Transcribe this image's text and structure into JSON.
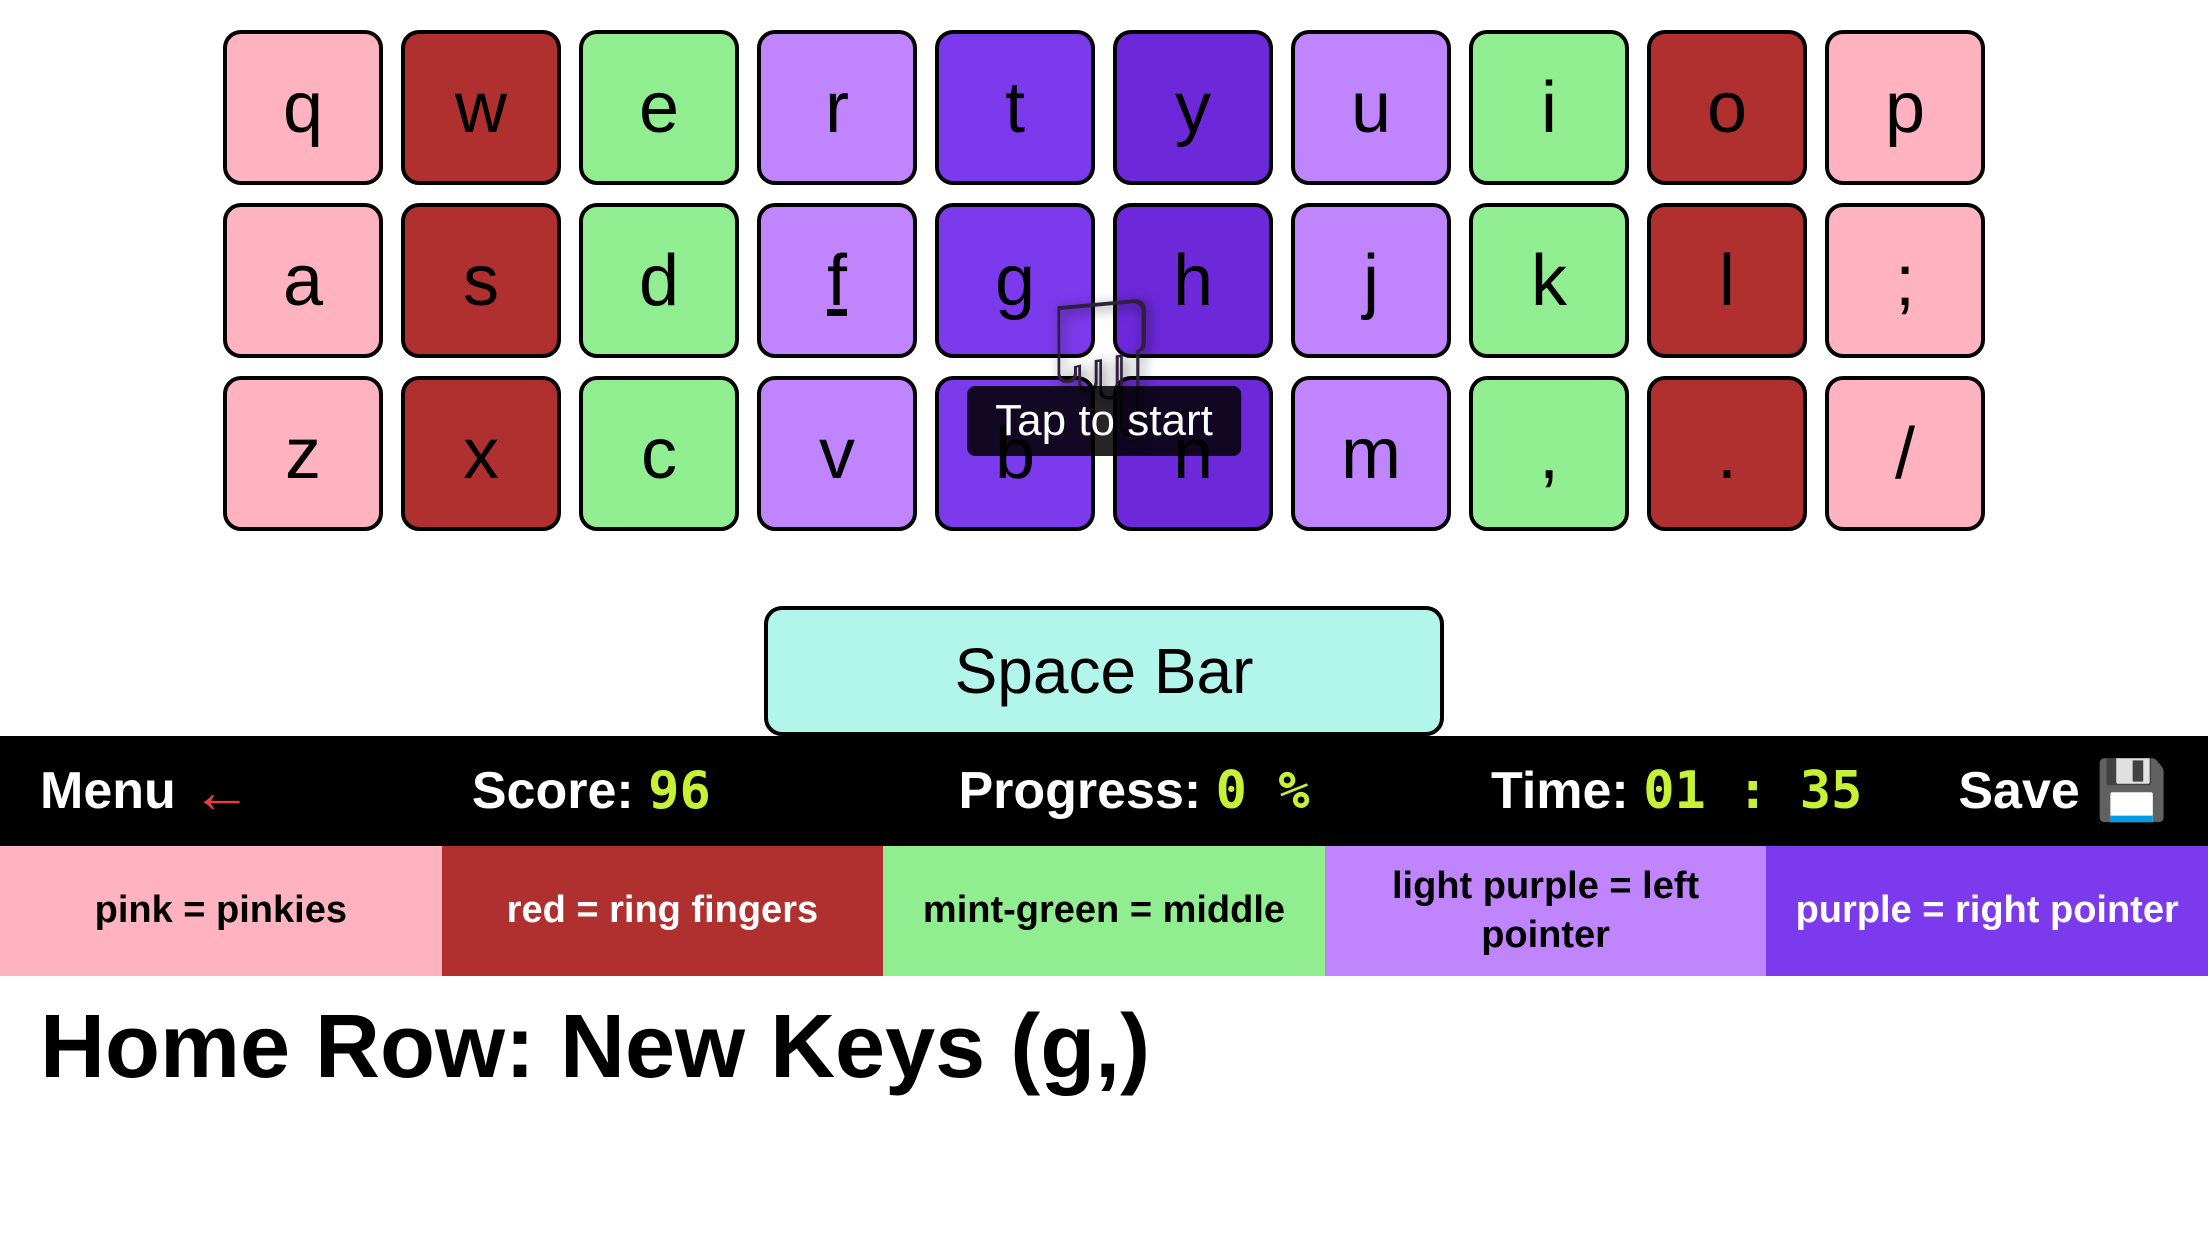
{
  "keyboard": {
    "rows": [
      [
        {
          "key": "q",
          "color": "pink"
        },
        {
          "key": "w",
          "color": "red"
        },
        {
          "key": "e",
          "color": "green"
        },
        {
          "key": "r",
          "color": "light-purple"
        },
        {
          "key": "t",
          "color": "purple"
        },
        {
          "key": "y",
          "color": "dark-purple"
        },
        {
          "key": "u",
          "color": "light-purple"
        },
        {
          "key": "i",
          "color": "green"
        },
        {
          "key": "o",
          "color": "red"
        },
        {
          "key": "p",
          "color": "pink"
        }
      ],
      [
        {
          "key": "a",
          "color": "pink"
        },
        {
          "key": "s",
          "color": "red"
        },
        {
          "key": "d",
          "color": "green"
        },
        {
          "key": "f",
          "color": "light-purple",
          "underline": true
        },
        {
          "key": "g",
          "color": "purple"
        },
        {
          "key": "h",
          "color": "dark-purple"
        },
        {
          "key": "j",
          "color": "light-purple"
        },
        {
          "key": "k",
          "color": "green"
        },
        {
          "key": "l",
          "color": "red"
        },
        {
          "key": ";",
          "color": "pink"
        }
      ],
      [
        {
          "key": "z",
          "color": "pink"
        },
        {
          "key": "x",
          "color": "red"
        },
        {
          "key": "c",
          "color": "green"
        },
        {
          "key": "v",
          "color": "light-purple"
        },
        {
          "key": "b",
          "color": "purple"
        },
        {
          "key": "n",
          "color": "dark-purple"
        },
        {
          "key": "m",
          "color": "light-purple"
        },
        {
          "key": ",",
          "color": "green"
        },
        {
          "key": ".",
          "color": "red"
        },
        {
          "key": "/",
          "color": "pink"
        }
      ]
    ],
    "spacebar_label": "Space Bar"
  },
  "tooltip": {
    "text": "Tap to start"
  },
  "statusbar": {
    "menu_label": "Menu",
    "score_label": "Score:",
    "score_value": "96",
    "progress_label": "Progress:",
    "progress_value": "0 %",
    "time_label": "Time:",
    "time_value": "01 : 35",
    "save_label": "Save"
  },
  "legend": [
    {
      "label": "pink = pinkies",
      "color": "pink"
    },
    {
      "label": "red = ring fingers",
      "color": "red"
    },
    {
      "label": "mint-green = middle",
      "color": "green"
    },
    {
      "label": "light purple = left pointer",
      "color": "light-purple"
    },
    {
      "label": "purple = right pointer",
      "color": "purple"
    }
  ],
  "bottom_title": "Home Row: New Keys (g,)"
}
